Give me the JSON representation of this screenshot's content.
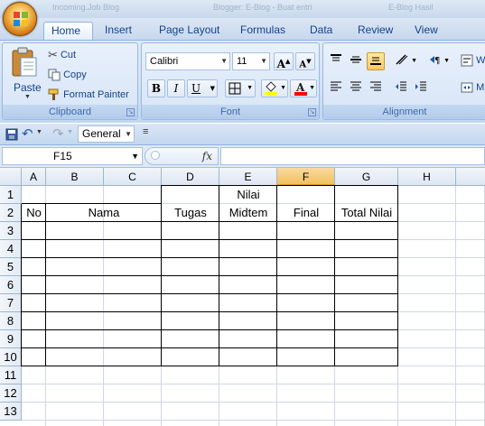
{
  "window": {
    "ghost_titles": [
      "Incoming.Job Blog",
      "Blogger: E‑Blog ‑ Buat entri",
      "E‑Blog Hasil"
    ]
  },
  "tabs": [
    {
      "label": "Home",
      "active": true
    },
    {
      "label": "Insert"
    },
    {
      "label": "Page Layout"
    },
    {
      "label": "Formulas"
    },
    {
      "label": "Data"
    },
    {
      "label": "Review"
    },
    {
      "label": "View"
    }
  ],
  "clipboard": {
    "paste": "Paste",
    "cut": "Cut",
    "copy": "Copy",
    "format_painter": "Format Painter",
    "group_label": "Clipboard"
  },
  "font": {
    "name": "Calibri",
    "size": "11",
    "group_label": "Font",
    "grow_glyph": "A",
    "shrink_glyph": "A",
    "bold": "B",
    "italic": "I",
    "underline": "U",
    "font_color_glyph": "A",
    "colors": {
      "highlight": "#ffff00",
      "font": "#ff0000"
    }
  },
  "alignment": {
    "group_label": "Alignment",
    "wrap_label": "W",
    "merge_label": "M"
  },
  "qat": {
    "number_format": "General"
  },
  "formula_bar": {
    "name_box": "F15",
    "fx": "fx",
    "value": ""
  },
  "sheet": {
    "columns": [
      "A",
      "B",
      "C",
      "D",
      "E",
      "F",
      "G",
      "H"
    ],
    "active_column": "F",
    "rows": [
      "1",
      "2",
      "3",
      "4",
      "5",
      "6",
      "7",
      "8",
      "9",
      "10",
      "11",
      "12",
      "13"
    ],
    "cells": {
      "nilai": "Nilai",
      "no": "No",
      "nama": "Nama",
      "tugas": "Tugas",
      "midtem": "Midtem",
      "final": "Final",
      "total_nilai": "Total Nilai"
    }
  }
}
